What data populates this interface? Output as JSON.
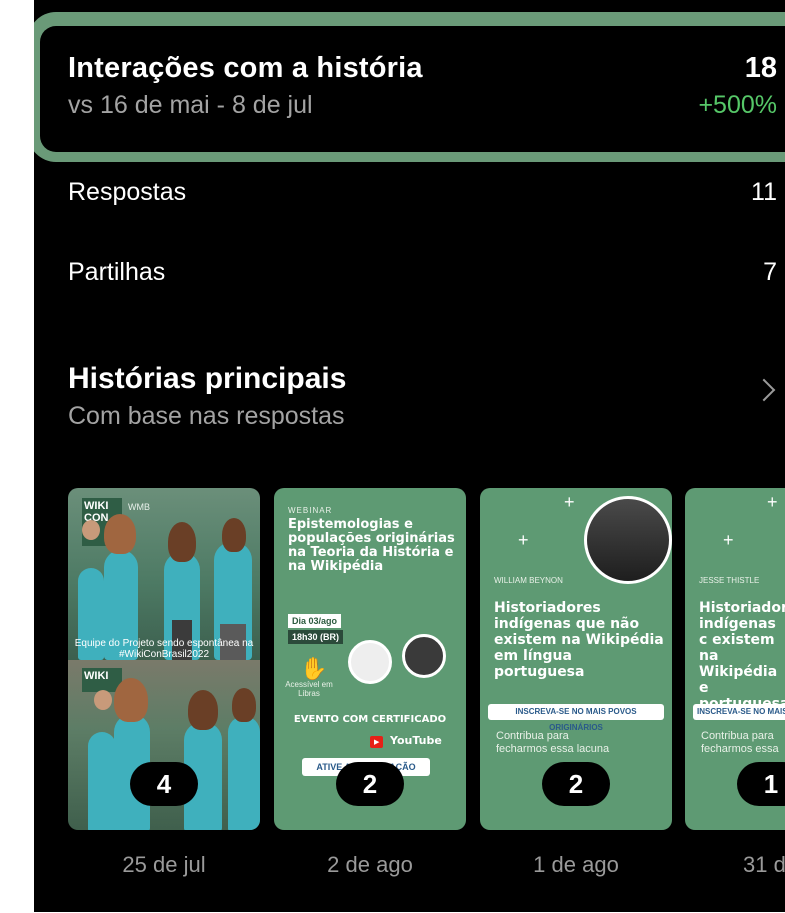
{
  "header": {
    "title": "Interações com a história",
    "subtitle": "vs 16 de mai - 8 de jul",
    "value": "18",
    "change": "+500%"
  },
  "rows": [
    {
      "label": "Respostas",
      "value": "11"
    },
    {
      "label": "Partilhas",
      "value": "7"
    }
  ],
  "top_stories": {
    "title": "Histórias principais",
    "subtitle": "Com base nas respostas",
    "items": [
      {
        "count": "4",
        "date": "25 de jul",
        "caption": "Equipe do Projeto sendo espontânea na #WikiConBrasil2022"
      },
      {
        "count": "2",
        "date": "2 de ago",
        "webinar": "WEBINAR",
        "title": "Epistemologias e populações originárias na Teoria da História e na Wikipédia",
        "day": "Dia 03/ago",
        "time": "18h30 (BR)",
        "access": "Acessível em Libras",
        "event": "EVENTO COM CERTIFICADO",
        "youtube": "YouTube",
        "cta": "ATIVE A NOTIFICAÇÃO"
      },
      {
        "count": "2",
        "date": "1 de ago",
        "name": "WILLIAM BEYNON",
        "title": "Historiadores indígenas que não existem na Wikipédia em língua portuguesa",
        "cta": "INSCREVA-SE NO MAIS POVOS ORIGINÁRIOS",
        "bottom": "Contribua para fecharmos essa lacuna"
      },
      {
        "count": "1",
        "date": "31 de",
        "name": "JESSE THISTLE",
        "title": "Historiador indígenas c existem na Wikipédia e portuguesa",
        "cta": "INSCREVA-SE NO MAIS",
        "bottom": "Contribua para fecharmos essa"
      }
    ]
  },
  "colors": {
    "accent_green": "#56c768",
    "highlight_border": "#6a9a78",
    "poster_green": "#5e9a73"
  }
}
